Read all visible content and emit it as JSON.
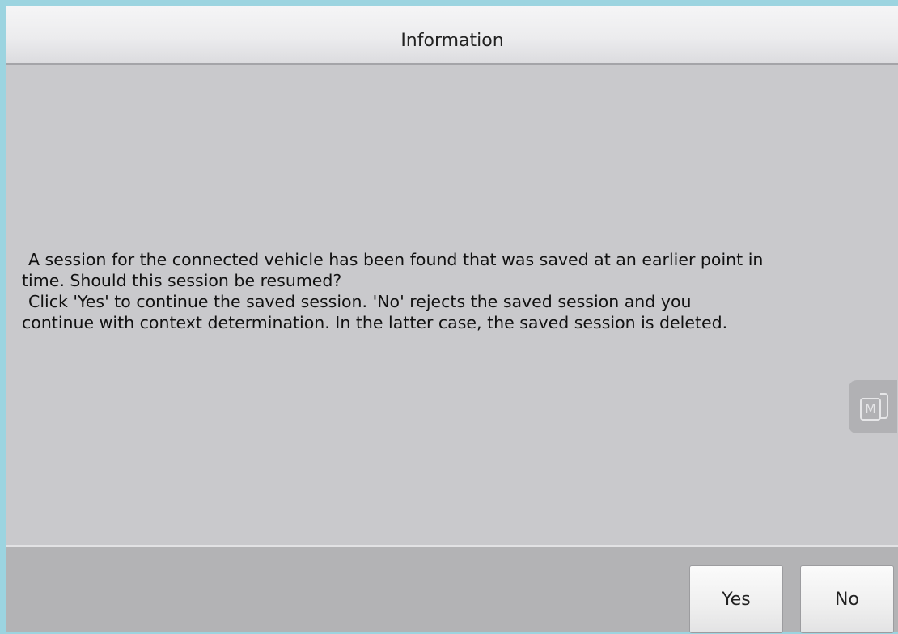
{
  "dialog": {
    "title": "Information",
    "message": {
      "line1": "A session for the connected vehicle has been found that was saved at an earlier point in",
      "line2": "time. Should this session be resumed?",
      "line3": "Click 'Yes' to continue the saved session. 'No' rejects the saved session and you",
      "line4": "continue with context determination. In the latter case, the saved session is deleted."
    },
    "buttons": {
      "yes_label": "Yes",
      "no_label": "No"
    }
  },
  "floating_button": {
    "icon": "m-icon",
    "glyph": "M"
  },
  "colors": {
    "background": "#9cd4e0",
    "dialog_body": "#c9c9cc",
    "footer": "#b3b3b5",
    "floating_button": "#b1b1b4"
  }
}
